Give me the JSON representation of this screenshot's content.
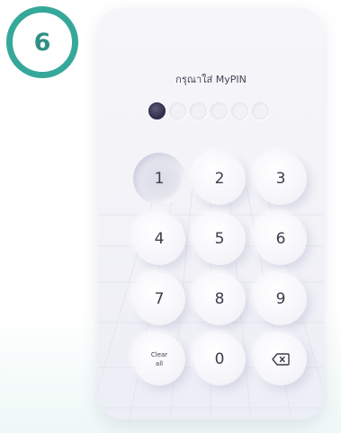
{
  "step": {
    "number": "6"
  },
  "screen": {
    "title": "กรุณาใส่ MyPIN"
  },
  "pin": {
    "length": 6,
    "entered": 1
  },
  "keypad": {
    "keys": [
      "1",
      "2",
      "3",
      "4",
      "5",
      "6",
      "7",
      "8",
      "9"
    ],
    "zero": "0",
    "clear_line1": "Clear",
    "clear_line2": "all",
    "backspace_icon": "backspace-icon"
  },
  "colors": {
    "badge_ring": "#35a89a",
    "badge_text": "#2f8f84",
    "dot_filled": "#302f4a",
    "key_text": "#3a3d4b"
  }
}
